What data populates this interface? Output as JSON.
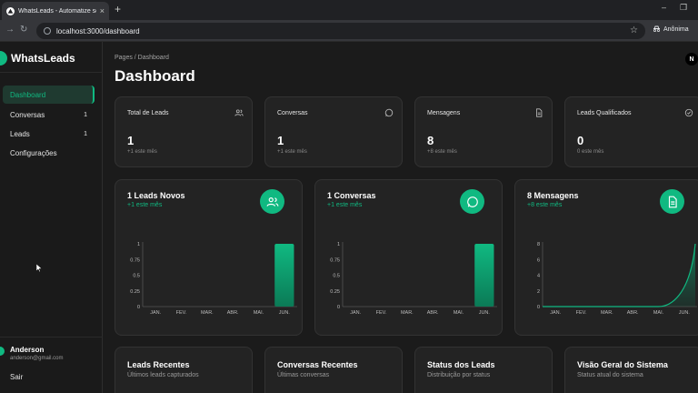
{
  "browser": {
    "tab_title": "WhatsLeads - Automatize seu WhatsApp",
    "tab_close": "×",
    "new_tab": "+",
    "url": "localhost:3000/dashboard",
    "incognito_label": "Anônima"
  },
  "sidebar": {
    "brand": "WhatsLeads",
    "items": [
      {
        "label": "Dashboard",
        "count": "",
        "active": true
      },
      {
        "label": "Conversas",
        "count": "1",
        "active": false
      },
      {
        "label": "Leads",
        "count": "1",
        "active": false
      },
      {
        "label": "Configurações",
        "count": "",
        "active": false
      }
    ],
    "user": {
      "name": "Anderson",
      "email": "anderson@gmail.com"
    },
    "logout": "Sair"
  },
  "header": {
    "breadcrumb": "Pages / Dashboard",
    "title": "Dashboard",
    "avatar_letter": "N"
  },
  "stats": [
    {
      "title": "Total de Leads",
      "value": "1",
      "sub": "+1 este mês",
      "icon": "users-icon"
    },
    {
      "title": "Conversas",
      "value": "1",
      "sub": "+1 este mês",
      "icon": "message-circle-icon"
    },
    {
      "title": "Mensagens",
      "value": "8",
      "sub": "+8 este mês",
      "icon": "file-text-icon"
    },
    {
      "title": "Leads Qualificados",
      "value": "0",
      "sub": "0 este mês",
      "icon": "check-circle-icon"
    }
  ],
  "chart_cards": [
    {
      "title": "1 Leads Novos",
      "sub": "+1 este mês",
      "icon": "users-icon"
    },
    {
      "title": "1 Conversas",
      "sub": "+1 este mês",
      "icon": "message-circle-icon"
    },
    {
      "title": "8 Mensagens",
      "sub": "+8 este mês",
      "icon": "file-text-icon"
    }
  ],
  "chart_data": [
    {
      "type": "bar",
      "categories": [
        "JAN.",
        "FEV.",
        "MAR.",
        "ABR.",
        "MAI.",
        "JUN."
      ],
      "values": [
        0,
        0,
        0,
        0,
        0,
        1
      ],
      "yticks": [
        "0",
        "0.25",
        "0.5",
        "0.75",
        "1"
      ],
      "ylim": [
        0,
        1
      ],
      "title": "1 Leads Novos",
      "xlabel": "",
      "ylabel": ""
    },
    {
      "type": "bar",
      "categories": [
        "JAN.",
        "FEV.",
        "MAR.",
        "ABR.",
        "MAI.",
        "JUN."
      ],
      "values": [
        0,
        0,
        0,
        0,
        0,
        1
      ],
      "yticks": [
        "0",
        "0.25",
        "0.5",
        "0.75",
        "1"
      ],
      "ylim": [
        0,
        1
      ],
      "title": "1 Conversas",
      "xlabel": "",
      "ylabel": ""
    },
    {
      "type": "area",
      "categories": [
        "JAN.",
        "FEV.",
        "MAR.",
        "ABR.",
        "MAI.",
        "JUN."
      ],
      "values": [
        0,
        0,
        0,
        0,
        0,
        8
      ],
      "yticks": [
        "0",
        "2",
        "4",
        "6",
        "8"
      ],
      "ylim": [
        0,
        8
      ],
      "title": "8 Mensagens",
      "xlabel": "",
      "ylabel": ""
    }
  ],
  "bottom_cards": [
    {
      "title": "Leads Recentes",
      "sub": "Últimos leads capturados"
    },
    {
      "title": "Conversas Recentes",
      "sub": "Últimas conversas"
    },
    {
      "title": "Status dos Leads",
      "sub": "Distribuição por status"
    },
    {
      "title": "Visão Geral do Sistema",
      "sub": "Status atual do sistema"
    }
  ],
  "colors": {
    "accent": "#10b981",
    "card": "#232323",
    "background": "#1b1b1b"
  }
}
